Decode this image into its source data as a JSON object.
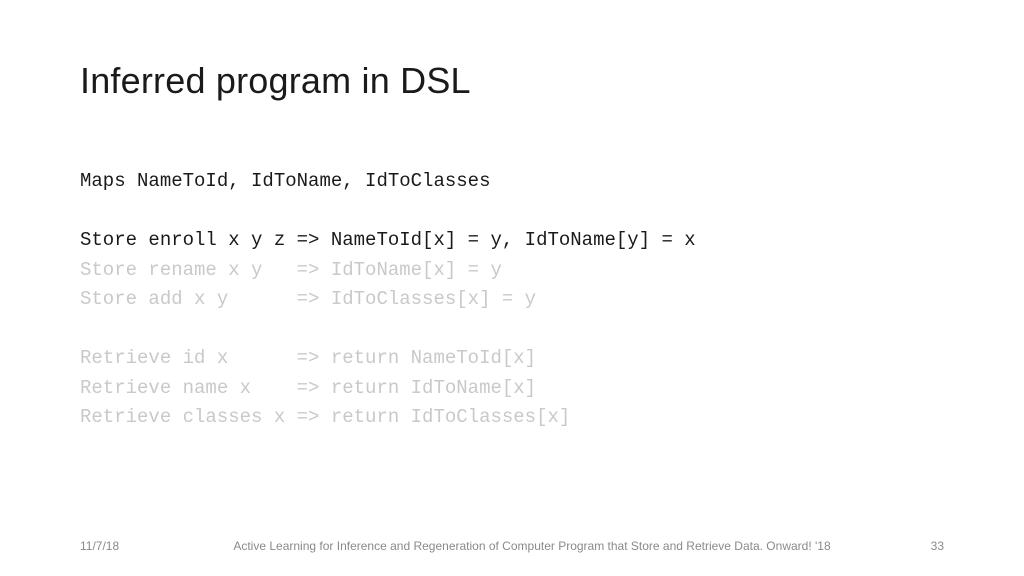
{
  "title": "Inferred program in DSL",
  "code": {
    "maps": "Maps NameToId, IdToName, IdToClasses",
    "enroll": "Store enroll x y z => NameToId[x] = y, IdToName[y] = x",
    "rename": "Store rename x y   => IdToName[x] = y",
    "add": "Store add x y      => IdToClasses[x] = y",
    "rid": "Retrieve id x      => return NameToId[x]",
    "rname": "Retrieve name x    => return IdToName[x]",
    "rclasses": "Retrieve classes x => return IdToClasses[x]"
  },
  "footer": {
    "date": "11/7/18",
    "caption": "Active Learning for Inference and Regeneration of Computer\nProgram that Store and Retrieve Data. Onward! '18",
    "page": "33"
  }
}
